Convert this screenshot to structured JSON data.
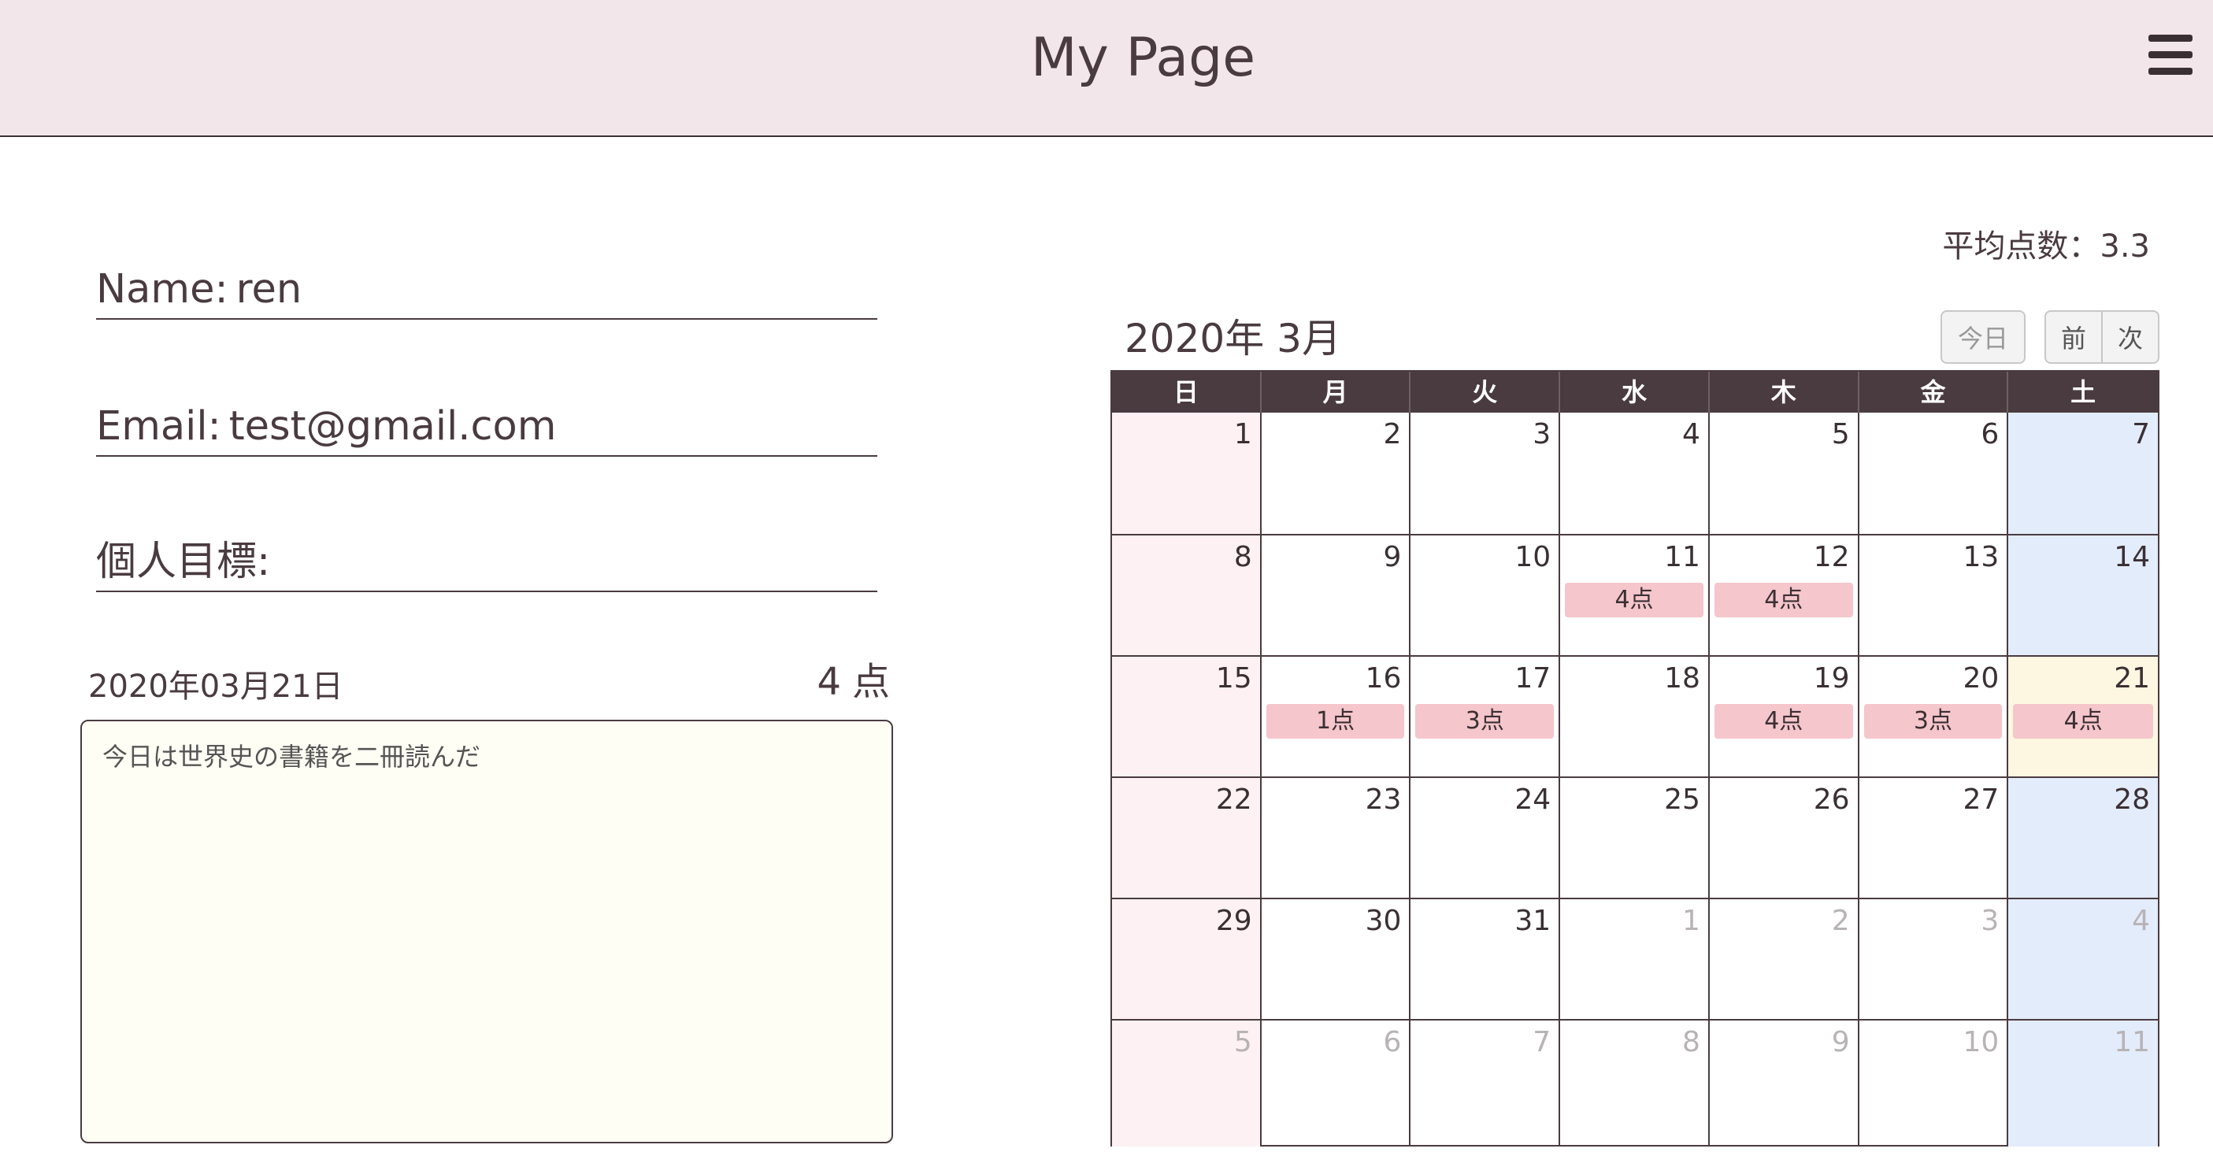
{
  "header": {
    "title": "My Page",
    "menu_icon": "hamburger-menu-icon"
  },
  "profile": {
    "name_label": "Name:",
    "name_value": "ren",
    "email_label": "Email:",
    "email_value": "test@gmail.com",
    "goal_label": "個人目標:",
    "goal_value": ""
  },
  "entry": {
    "date": "2020年03月21日",
    "score": "4",
    "score_unit": "点",
    "memo": "今日は世界史の書籍を二冊読んだ"
  },
  "average": "平均点数：3.3",
  "calendar": {
    "title": "2020年 3月",
    "today_label": "今日",
    "prev_label": "前",
    "next_label": "次",
    "weekdays": [
      "日",
      "月",
      "火",
      "水",
      "木",
      "金",
      "土"
    ],
    "weeks": [
      [
        {
          "d": "1"
        },
        {
          "d": "2"
        },
        {
          "d": "3"
        },
        {
          "d": "4"
        },
        {
          "d": "5"
        },
        {
          "d": "6"
        },
        {
          "d": "7"
        }
      ],
      [
        {
          "d": "8"
        },
        {
          "d": "9"
        },
        {
          "d": "10"
        },
        {
          "d": "11",
          "e": "4点"
        },
        {
          "d": "12",
          "e": "4点"
        },
        {
          "d": "13"
        },
        {
          "d": "14"
        }
      ],
      [
        {
          "d": "15"
        },
        {
          "d": "16",
          "e": "1点"
        },
        {
          "d": "17",
          "e": "3点"
        },
        {
          "d": "18"
        },
        {
          "d": "19",
          "e": "4点"
        },
        {
          "d": "20",
          "e": "3点"
        },
        {
          "d": "21",
          "e": "4点",
          "today": true
        }
      ],
      [
        {
          "d": "22"
        },
        {
          "d": "23"
        },
        {
          "d": "24"
        },
        {
          "d": "25"
        },
        {
          "d": "26"
        },
        {
          "d": "27"
        },
        {
          "d": "28"
        }
      ],
      [
        {
          "d": "29"
        },
        {
          "d": "30"
        },
        {
          "d": "31"
        },
        {
          "d": "1",
          "other": true
        },
        {
          "d": "2",
          "other": true
        },
        {
          "d": "3",
          "other": true
        },
        {
          "d": "4",
          "other": true
        }
      ],
      [
        {
          "d": "5",
          "other": true
        },
        {
          "d": "6",
          "other": true
        },
        {
          "d": "7",
          "other": true
        },
        {
          "d": "8",
          "other": true
        },
        {
          "d": "9",
          "other": true
        },
        {
          "d": "10",
          "other": true
        },
        {
          "d": "11",
          "other": true
        }
      ]
    ]
  }
}
